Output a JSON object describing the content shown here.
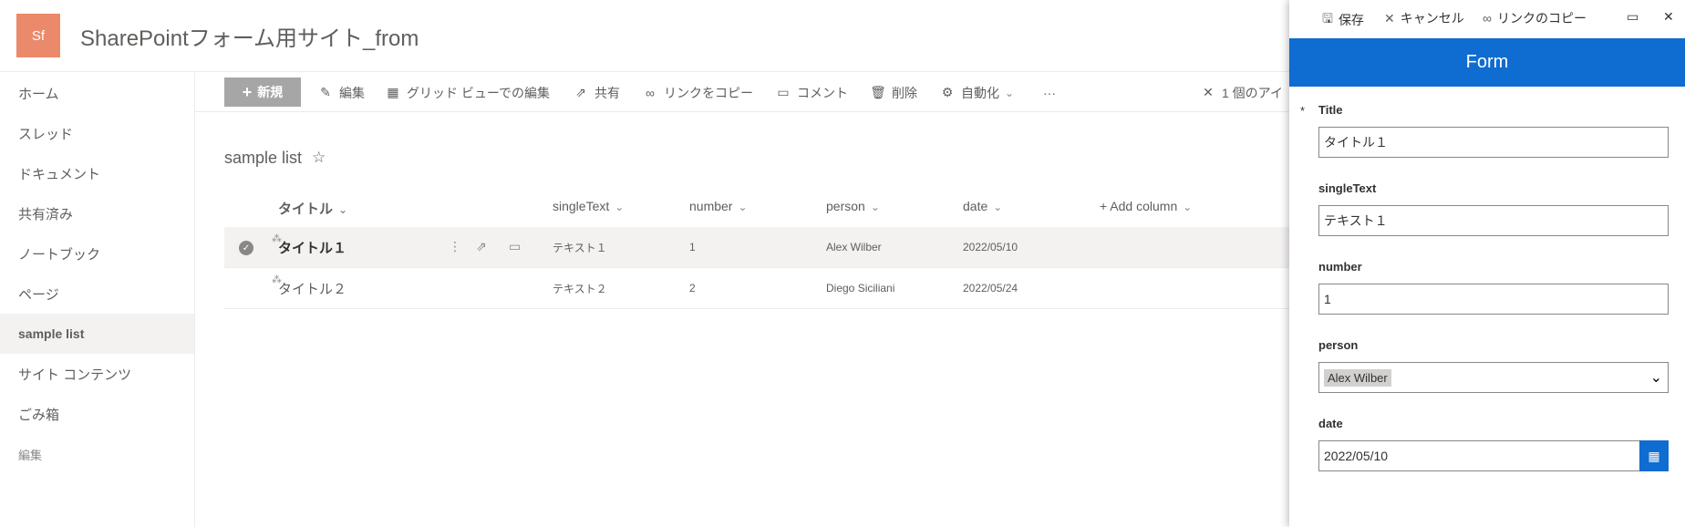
{
  "site": {
    "logo_text": "Sf",
    "title": "SharePointフォーム用サイト_from"
  },
  "nav": {
    "items": [
      "ホーム",
      "スレッド",
      "ドキュメント",
      "共有済み",
      "ノートブック",
      "ページ",
      "sample list",
      "サイト コンテンツ",
      "ごみ箱",
      "編集"
    ],
    "selected": "sample list"
  },
  "commands": {
    "new": "新規",
    "edit": "編集",
    "grid_edit": "グリッド ビューでの編集",
    "share": "共有",
    "copy_link": "リンクをコピー",
    "comment": "コメント",
    "delete": "削除",
    "automate": "自動化",
    "more": "···",
    "selection": "1 個のアイ"
  },
  "list": {
    "title": "sample list",
    "columns": [
      "タイトル",
      "singleText",
      "number",
      "person",
      "date",
      "Add column"
    ],
    "rows": [
      {
        "title": "タイトル１",
        "singleText": "テキスト１",
        "number": "1",
        "person": "Alex Wilber",
        "date": "2022/05/10",
        "selected": true
      },
      {
        "title": "タイトル２",
        "singleText": "テキスト２",
        "number": "2",
        "person": "Diego Siciliani",
        "date": "2022/05/24",
        "selected": false
      }
    ]
  },
  "panel": {
    "save": "保存",
    "cancel": "キャンセル",
    "copy_link": "リンクのコピー",
    "banner": "Form",
    "required_mark": "*",
    "fields": {
      "title_label": "Title",
      "title_value": "タイトル１",
      "singletext_label": "singleText",
      "singletext_value": "テキスト１",
      "number_label": "number",
      "number_value": "1",
      "person_label": "person",
      "person_value": "Alex Wilber",
      "date_label": "date",
      "date_value": "2022/05/10"
    }
  },
  "colors": {
    "brand": "#0f6cd0",
    "logo": "#ea8a6b",
    "new_button": "#a6a6a6"
  }
}
